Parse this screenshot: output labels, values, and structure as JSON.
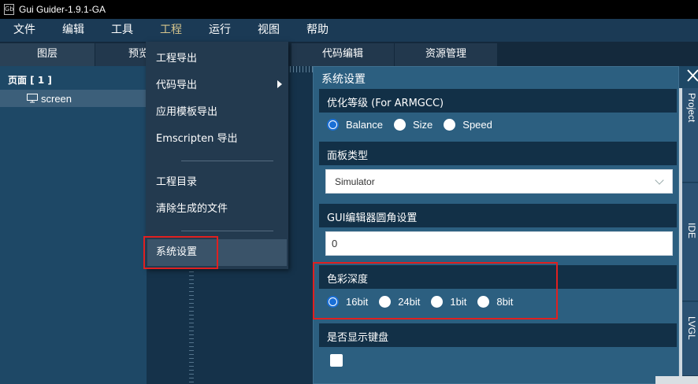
{
  "window": {
    "title": "Gui Guider-1.9.1-GA"
  },
  "menubar": {
    "items": [
      "文件",
      "编辑",
      "工具",
      "工程",
      "运行",
      "视图",
      "帮助"
    ],
    "active_index": 3
  },
  "tabs": [
    "图层",
    "预览",
    "代码编辑",
    "资源管理"
  ],
  "layers": {
    "page_heading": "页面 [ 1 ]",
    "screen_label": "screen"
  },
  "project_menu": {
    "items": [
      "工程导出",
      "代码导出",
      "应用模板导出",
      "Emscripten 导出",
      "工程目录",
      "清除生成的文件",
      "系统设置"
    ],
    "highlighted": "系统设置",
    "submenu_item": "代码导出"
  },
  "settings": {
    "title": "系统设置",
    "optimization": {
      "label": "优化等级 (For ARMGCC)",
      "options": [
        "Balance",
        "Size",
        "Speed"
      ],
      "selected": "Balance"
    },
    "panel_type": {
      "label": "面板类型",
      "value": "Simulator"
    },
    "corner_radius": {
      "label": "GUI编辑器圆角设置",
      "value": "0"
    },
    "color_depth": {
      "label": "色彩深度",
      "options": [
        "16bit",
        "24bit",
        "1bit",
        "8bit"
      ],
      "selected": "16bit"
    },
    "keyboard": {
      "label": "是否显示键盘",
      "checked": false
    }
  },
  "right_tabs": [
    "Project",
    "IDE",
    "LVGL"
  ],
  "colors": {
    "accent_active_menu": "#d6c58d",
    "radio_selected": "#1a6fd6",
    "highlight_box": "#e02020"
  }
}
